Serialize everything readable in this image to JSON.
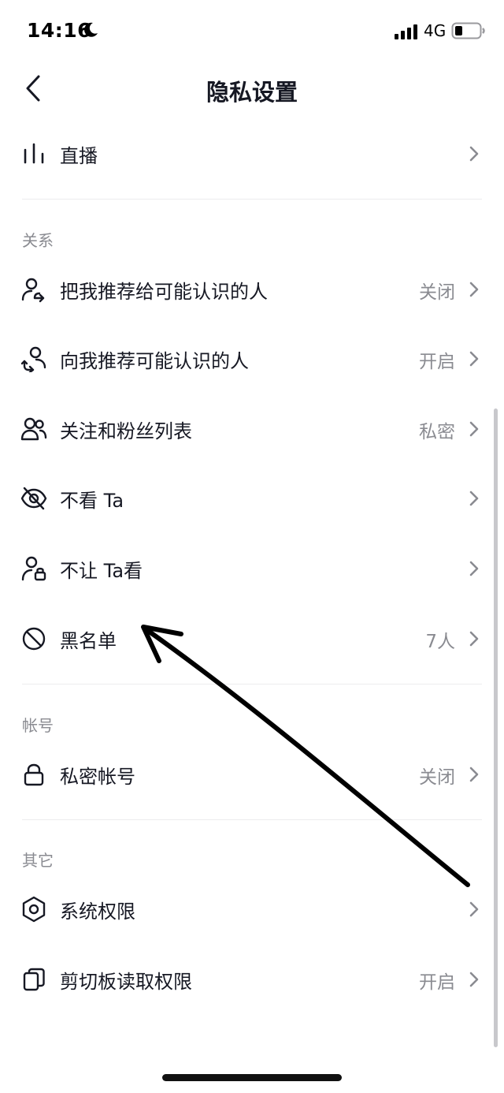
{
  "status_bar": {
    "time": "14:16",
    "network": "4G",
    "icons": [
      "moon-icon",
      "signal-icon",
      "battery-icon"
    ]
  },
  "nav": {
    "title": "隐私设置",
    "back_icon": "back-arrow-icon"
  },
  "rows": {
    "live": {
      "label": "直播",
      "value": "",
      "icon": "live-bars-icon"
    },
    "recommend_me": {
      "label": "把我推荐给可能认识的人",
      "value": "关闭",
      "icon": "user-share-icon"
    },
    "recommend_to_me": {
      "label": "向我推荐可能认识的人",
      "value": "开启",
      "icon": "user-recommend-icon"
    },
    "follow_list": {
      "label": "关注和粉丝列表",
      "value": "私密",
      "icon": "users-icon"
    },
    "hide_ta": {
      "label": "不看 Ta",
      "value": "",
      "icon": "eye-off-icon"
    },
    "block_ta": {
      "label": "不让 Ta看",
      "value": "",
      "icon": "user-lock-icon"
    },
    "blacklist": {
      "label": "黑名单",
      "value": "7人",
      "icon": "block-icon"
    },
    "private_account": {
      "label": "私密帐号",
      "value": "关闭",
      "icon": "lock-icon"
    },
    "system_permissions": {
      "label": "系统权限",
      "value": "",
      "icon": "hexagon-settings-icon"
    },
    "clipboard": {
      "label": "剪切板读取权限",
      "value": "开启",
      "icon": "clipboard-icon"
    }
  },
  "sections": {
    "relationship": "关系",
    "account": "帐号",
    "other": "其它"
  },
  "colors": {
    "text_primary": "#161823",
    "text_secondary": "#8a8b91",
    "divider": "#ececee",
    "annotation": "#000000"
  }
}
